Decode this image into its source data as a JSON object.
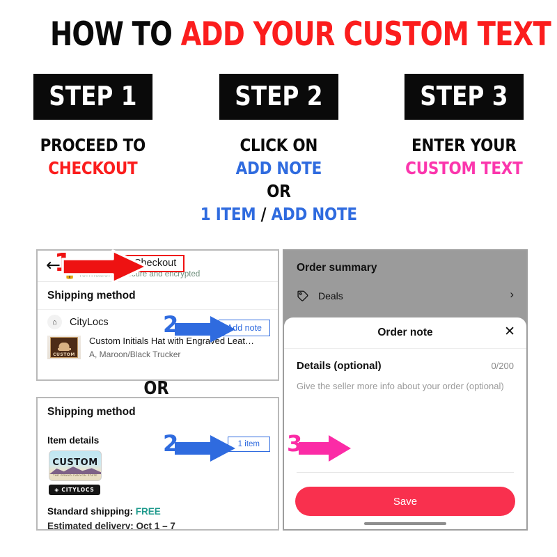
{
  "headline": {
    "black": "HOW TO ",
    "red": "ADD YOUR CUSTOM TEXT"
  },
  "steps": [
    {
      "badge": "STEP 1",
      "lines": [
        {
          "text": "PROCEED TO",
          "color": "black"
        },
        {
          "text": "CHECKOUT",
          "color": "red"
        }
      ]
    },
    {
      "badge": "STEP 2",
      "lines": [
        {
          "text": "CLICK ON",
          "color": "black"
        },
        {
          "text": "ADD NOTE",
          "color": "blue"
        },
        {
          "text": "OR",
          "color": "black"
        },
        {
          "text": "1 ITEM / ADD NOTE",
          "color": "blue"
        }
      ]
    },
    {
      "badge": "STEP 3",
      "lines": [
        {
          "text": "ENTER YOUR",
          "color": "black"
        },
        {
          "text": "CUSTOM TEXT",
          "color": "pink"
        }
      ]
    }
  ],
  "step2_mixed": {
    "part1": "1 ITEM",
    "slash": " / ",
    "part2": "ADD NOTE"
  },
  "screenshot_checkout": {
    "back_icon": "←",
    "callout_number": "1",
    "checkout_label": "Checkout",
    "secure_text": "formation is secure and encrypted",
    "shipping_method_title": "Shipping method",
    "seller_name": "CityLocs",
    "add_note_label": "Add note",
    "callout_number_2": "2",
    "product_title": "Custom Initials Hat with Engraved Leat…",
    "product_variant": "A, Maroon/Black Trucker",
    "product_thumb_word": "CUSTOM"
  },
  "or_divider": "OR",
  "screenshot_item": {
    "shipping_method_title": "Shipping method",
    "item_details_label": "Item details",
    "callout_number": "2",
    "one_item_label": "1 item",
    "plate_word": "CUSTOM",
    "plate_sub": "THE GRAND CANYON STATE",
    "brand_badge": "◈ CITYLOCS",
    "standard_shipping_label": "Standard shipping:",
    "standard_shipping_value": "FREE",
    "estimated_label": "Estimated delivery: Oct 1 – 7"
  },
  "screenshot_note": {
    "order_summary_title": "Order summary",
    "deals_label": "Deals",
    "chevron": "›",
    "sheet_title": "Order note",
    "close_icon": "✕",
    "details_label": "Details (optional)",
    "char_count": "0/200",
    "placeholder": "Give the seller more info about your order (optional)",
    "callout_number": "3",
    "save_label": "Save"
  },
  "colors": {
    "red": "#fb1d1d",
    "blue": "#2f6bdf",
    "pink": "#fb36ad",
    "black": "#0a0a0a",
    "save_button": "#f9304e",
    "free_green": "#1e9a8c"
  }
}
